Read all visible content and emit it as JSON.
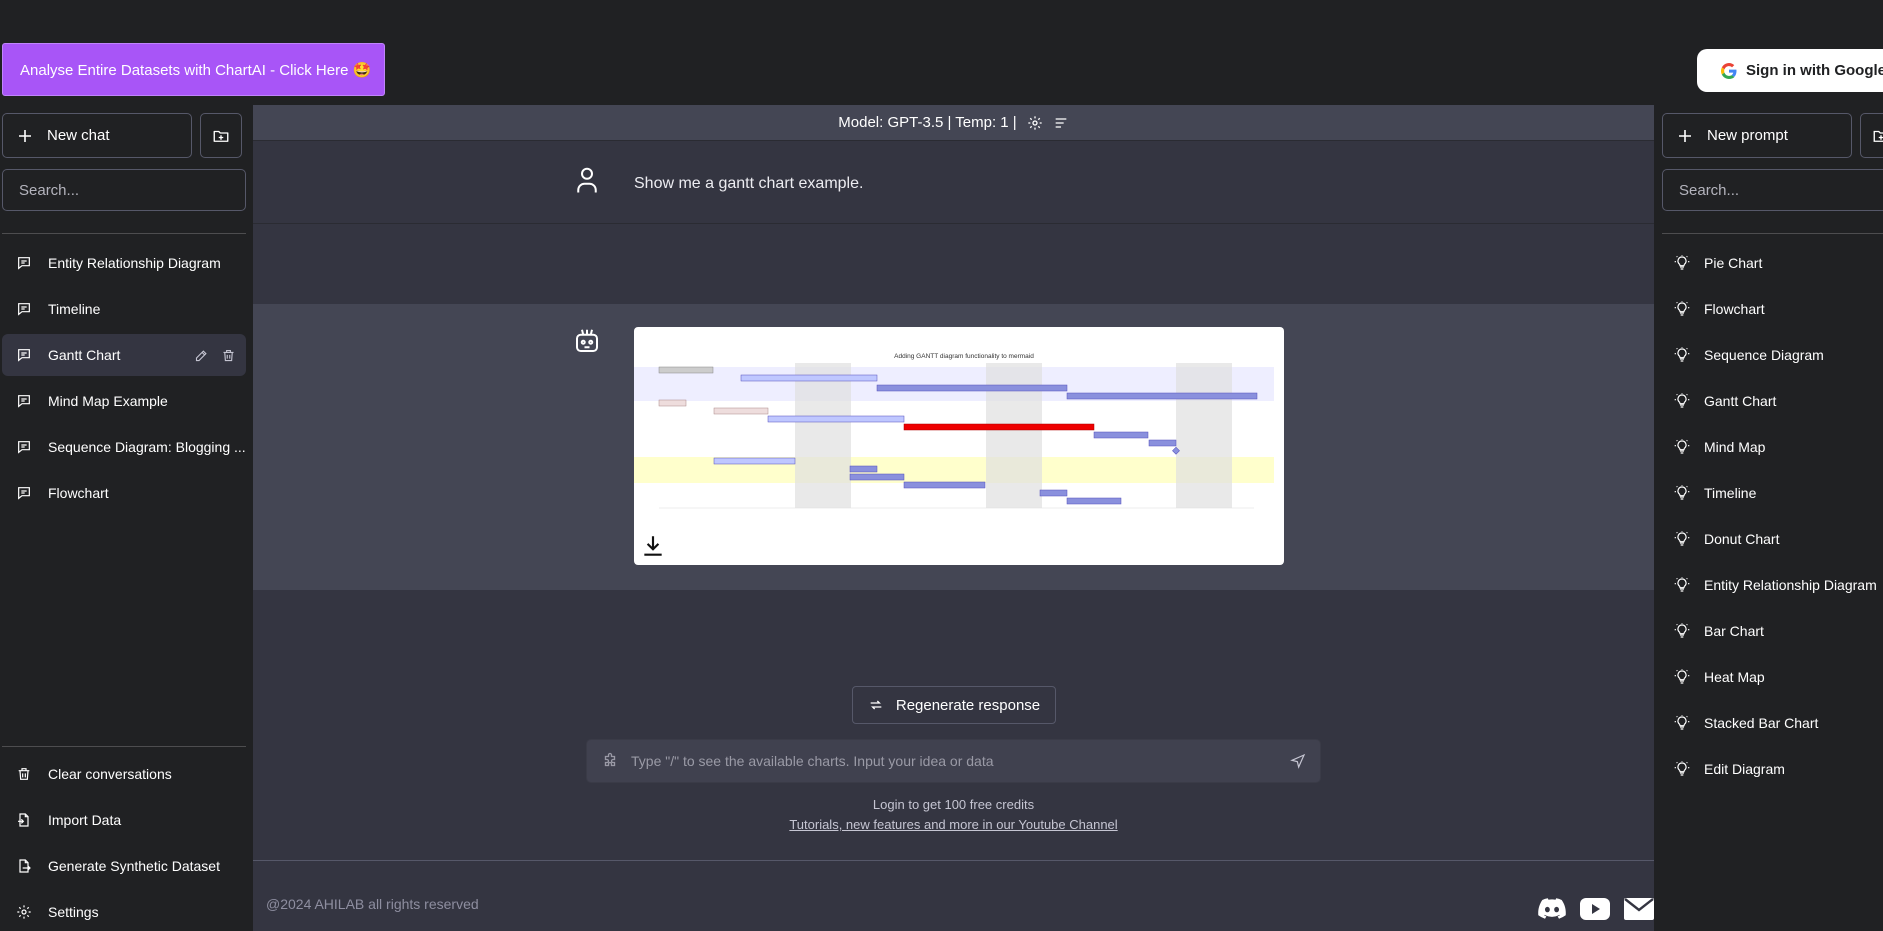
{
  "promo": {
    "label": "Analyse Entire Datasets with ChartAI - Click Here 🤩"
  },
  "auth": {
    "signin_label": "Sign in with Google"
  },
  "left_sidebar": {
    "new_chat_label": "New chat",
    "search_placeholder": "Search...",
    "conversations": [
      {
        "label": "Entity Relationship Diagram"
      },
      {
        "label": "Timeline"
      },
      {
        "label": "Gantt Chart",
        "active": true
      },
      {
        "label": "Mind Map Example"
      },
      {
        "label": "Sequence Diagram: Blogging ..."
      },
      {
        "label": "Flowchart"
      }
    ],
    "bottom_items": [
      {
        "label": "Clear conversations",
        "icon": "trash-icon"
      },
      {
        "label": "Import Data",
        "icon": "file-import-icon"
      },
      {
        "label": "Generate Synthetic Dataset",
        "icon": "file-export-icon"
      },
      {
        "label": "Settings",
        "icon": "gear-icon"
      }
    ]
  },
  "main": {
    "model_bar": "Model: GPT-3.5 | Temp: 1 |",
    "user_message": "Show me a gantt chart example.",
    "chart_title": "Adding GANTT diagram functionality to mermaid",
    "regenerate_label": "Regenerate response",
    "input_placeholder": "Type \"/\" to see the available charts. Input your idea or data",
    "credits_text": "Login to get 100 free credits",
    "youtube_link": "Tutorials, new features and more in our Youtube Channel",
    "copyright": "@2024 AHILAB all rights reserved"
  },
  "right_sidebar": {
    "new_prompt_label": "New prompt",
    "search_placeholder": "Search...",
    "prompts": [
      {
        "label": "Pie Chart"
      },
      {
        "label": "Flowchart"
      },
      {
        "label": "Sequence Diagram"
      },
      {
        "label": "Gantt Chart"
      },
      {
        "label": "Mind Map"
      },
      {
        "label": "Timeline"
      },
      {
        "label": "Donut Chart"
      },
      {
        "label": "Entity Relationship Diagram"
      },
      {
        "label": "Bar Chart"
      },
      {
        "label": "Heat Map"
      },
      {
        "label": "Stacked Bar Chart"
      },
      {
        "label": "Edit Diagram"
      }
    ]
  },
  "colors": {
    "accent_purple": "#a855f7",
    "sidebar_bg": "#202123",
    "main_bg": "#343541",
    "bot_msg_bg": "#444654"
  }
}
